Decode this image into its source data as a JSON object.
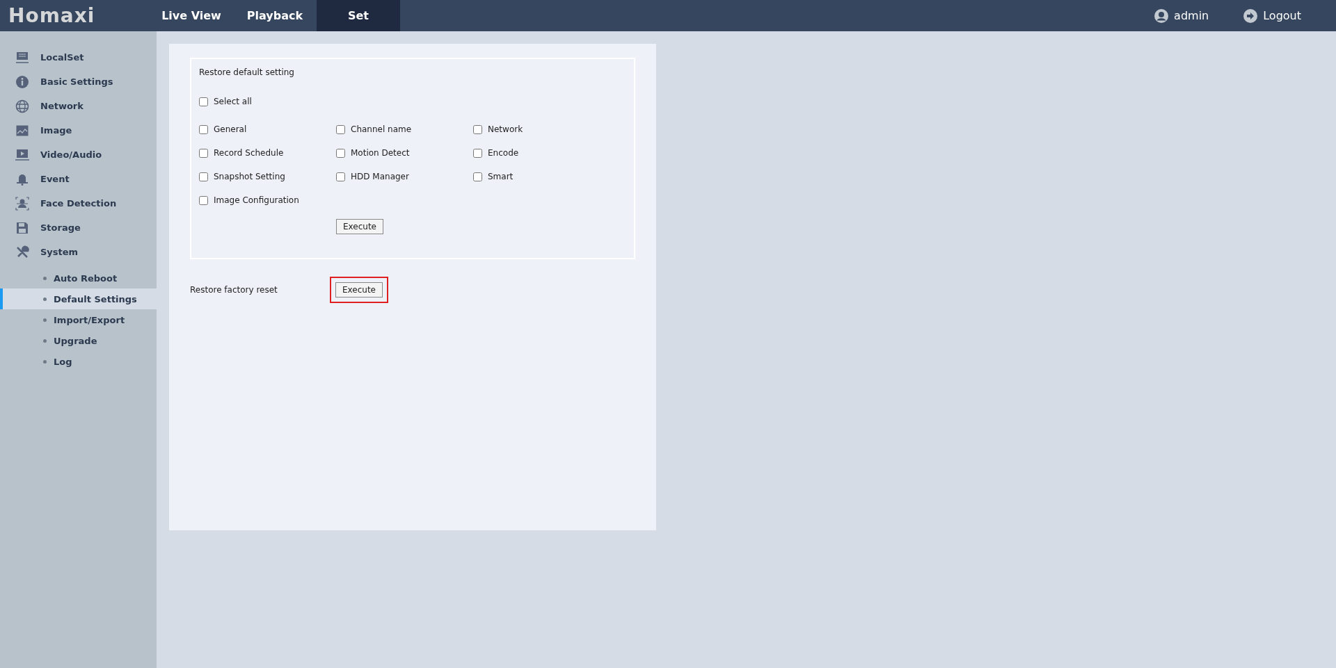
{
  "logo": "Homaxi",
  "nav_tabs": [
    {
      "label": "Live View",
      "selected": false
    },
    {
      "label": "Playback",
      "selected": false
    },
    {
      "label": "Set",
      "selected": true
    }
  ],
  "user": {
    "name": "admin"
  },
  "logout": {
    "label": "Logout"
  },
  "sidebar": {
    "items": [
      {
        "label": "LocalSet",
        "kind": "monitor"
      },
      {
        "label": "Basic Settings",
        "kind": "info"
      },
      {
        "label": "Network",
        "kind": "globe"
      },
      {
        "label": "Image",
        "kind": "image"
      },
      {
        "label": "Video/Audio",
        "kind": "video"
      },
      {
        "label": "Event",
        "kind": "bell"
      },
      {
        "label": "Face Detection",
        "kind": "face"
      },
      {
        "label": "Storage",
        "kind": "disk"
      },
      {
        "label": "System",
        "kind": "tools",
        "children": [
          {
            "label": "Auto Reboot",
            "selected": false
          },
          {
            "label": "Default Settings",
            "selected": true
          },
          {
            "label": "Import/Export",
            "selected": false
          },
          {
            "label": "Upgrade",
            "selected": false
          },
          {
            "label": "Log",
            "selected": false
          }
        ]
      }
    ]
  },
  "restore_default": {
    "title": "Restore default setting",
    "select_all": {
      "label": "Select all",
      "checked": false
    },
    "options": [
      {
        "label": "General",
        "checked": false
      },
      {
        "label": "Channel name",
        "checked": false
      },
      {
        "label": "Network",
        "checked": false
      },
      {
        "label": "Record Schedule",
        "checked": false
      },
      {
        "label": "Motion Detect",
        "checked": false
      },
      {
        "label": "Encode",
        "checked": false
      },
      {
        "label": "Snapshot Setting",
        "checked": false
      },
      {
        "label": "HDD Manager",
        "checked": false
      },
      {
        "label": "Smart",
        "checked": false
      },
      {
        "label": "Image Configuration",
        "checked": false
      }
    ],
    "button": "Execute"
  },
  "factory_reset": {
    "label": "Restore factory reset",
    "button": "Execute",
    "highlighted": true
  }
}
